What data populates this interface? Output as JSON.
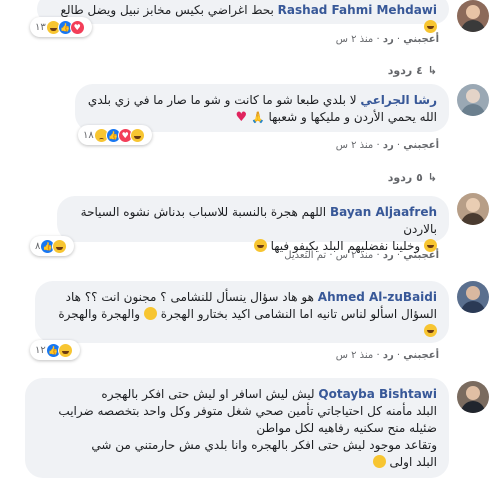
{
  "comments": [
    {
      "author": "Rashad Fahmi Mehdawi",
      "text": "بحط اغراضي بكيس مخابز نبيل ويضل طالع",
      "reactions": {
        "count": "١٣"
      },
      "actions": {
        "like": "أعجبني",
        "reply": "رد",
        "time": "منذ ٢ س"
      },
      "replies_label": "٤ ردود"
    },
    {
      "author": "رشا الجراعي",
      "text": "لا بلدي طبعا شو ما كانت و شو ما صار ما في زي بلدي",
      "text2": "الله يحمي الأردن و مليكها و شعبها",
      "reactions": {
        "count": "١٨"
      },
      "actions": {
        "like": "أعجبني",
        "reply": "رد",
        "time": "منذ ٢ س"
      },
      "replies_label": "٥ ردود"
    },
    {
      "author": "Bayan Aljaafreh",
      "text": "اللهم هجرة بالنسبة للاسباب بدناش نشوه السياحة بالاردن",
      "text2": "وخلينا نفضليهم البلد يكيفو فيها",
      "reactions": {
        "count": "٨"
      },
      "actions": {
        "like": "أعجبني",
        "reply": "رد",
        "time": "منذ ٢ س",
        "edited": "تم التعديل"
      }
    },
    {
      "author": "Ahmed Al-zuBaidi",
      "text": "هو هاد سؤال ينسأل للنشامى ؟ مجنون انت ؟؟ هاد",
      "text2": "السؤال اسألو لناس تانيه اما النشامى اكيد بختارو الهجرة",
      "text3": "والهجرة والهجرة",
      "reactions": {
        "count": "١٢"
      },
      "actions": {
        "like": "أعجبني",
        "reply": "رد",
        "time": "منذ ٢ س"
      }
    },
    {
      "author": "Qotayba Bishtawi",
      "text": "ليش ليش اسافر او ليش حتى افكر بالهجره",
      "text2": "البلد مأمنه كل احتياجاتي تأمين صحي شغل متوفر وكل واحد بتخصصه ضرايب",
      "text3": "ضئيله منح سكنيه رفاهيه لكل مواطن",
      "text4": "وتقاعد موجود ليش حتى افكر بالهجره وانا بلدي مش حارمتني من شي",
      "text5": "البلد اولى"
    }
  ]
}
